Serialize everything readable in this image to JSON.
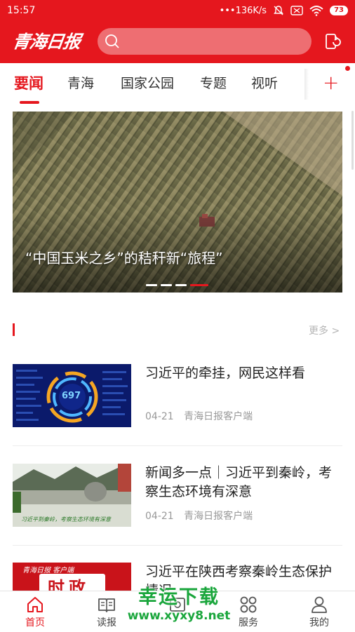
{
  "status_bar": {
    "time": "15:57",
    "network_speed": "•••136K/s",
    "battery": "73",
    "icons": [
      "bell-off-icon",
      "sim-icon",
      "wifi-icon",
      "battery-icon"
    ]
  },
  "header": {
    "logo_text": "青海日报",
    "search_placeholder": "",
    "action_icon": "refresh-phone-icon"
  },
  "tabs": {
    "items": [
      {
        "label": "要闻",
        "active": true
      },
      {
        "label": "青海",
        "active": false
      },
      {
        "label": "国家公园",
        "active": false
      },
      {
        "label": "专题",
        "active": false
      },
      {
        "label": "视听",
        "active": false
      }
    ],
    "add_label": "+"
  },
  "banner": {
    "caption": "“中国玉米之乡”的秸秆新“旅程”",
    "active_index": 3,
    "count": 4
  },
  "section": {
    "more_label": "更多 >"
  },
  "news": [
    {
      "title": "习近平的牵挂，网民这样看",
      "date": "04-21",
      "source": "青海日报客户端",
      "thumb_text": "697"
    },
    {
      "title": "新闻多一点｜习近平到秦岭，考察生态环境有深意",
      "date": "04-21",
      "source": "青海日报客户端",
      "thumb_text": "习近平到秦岭，考察生态环境有深意"
    },
    {
      "title": "习近平在陕西考察秦岭生态保护情况",
      "date": "",
      "source": "",
      "thumb_text": "时政",
      "thumb_logo": "青海日报 客户端"
    }
  ],
  "bottom_nav": {
    "items": [
      {
        "label": "首页",
        "icon": "home-icon",
        "active": true
      },
      {
        "label": "读报",
        "icon": "book-icon",
        "active": false
      },
      {
        "label": "",
        "icon": "center-icon",
        "active": false
      },
      {
        "label": "服务",
        "icon": "grid-icon",
        "active": false
      },
      {
        "label": "我的",
        "icon": "user-icon",
        "active": false
      }
    ]
  },
  "watermark": {
    "line1": "幸运下载",
    "line2": "www.xyxy8.net"
  },
  "colors": {
    "brand": "#e5171e",
    "text": "#222222",
    "meta": "#999999"
  }
}
